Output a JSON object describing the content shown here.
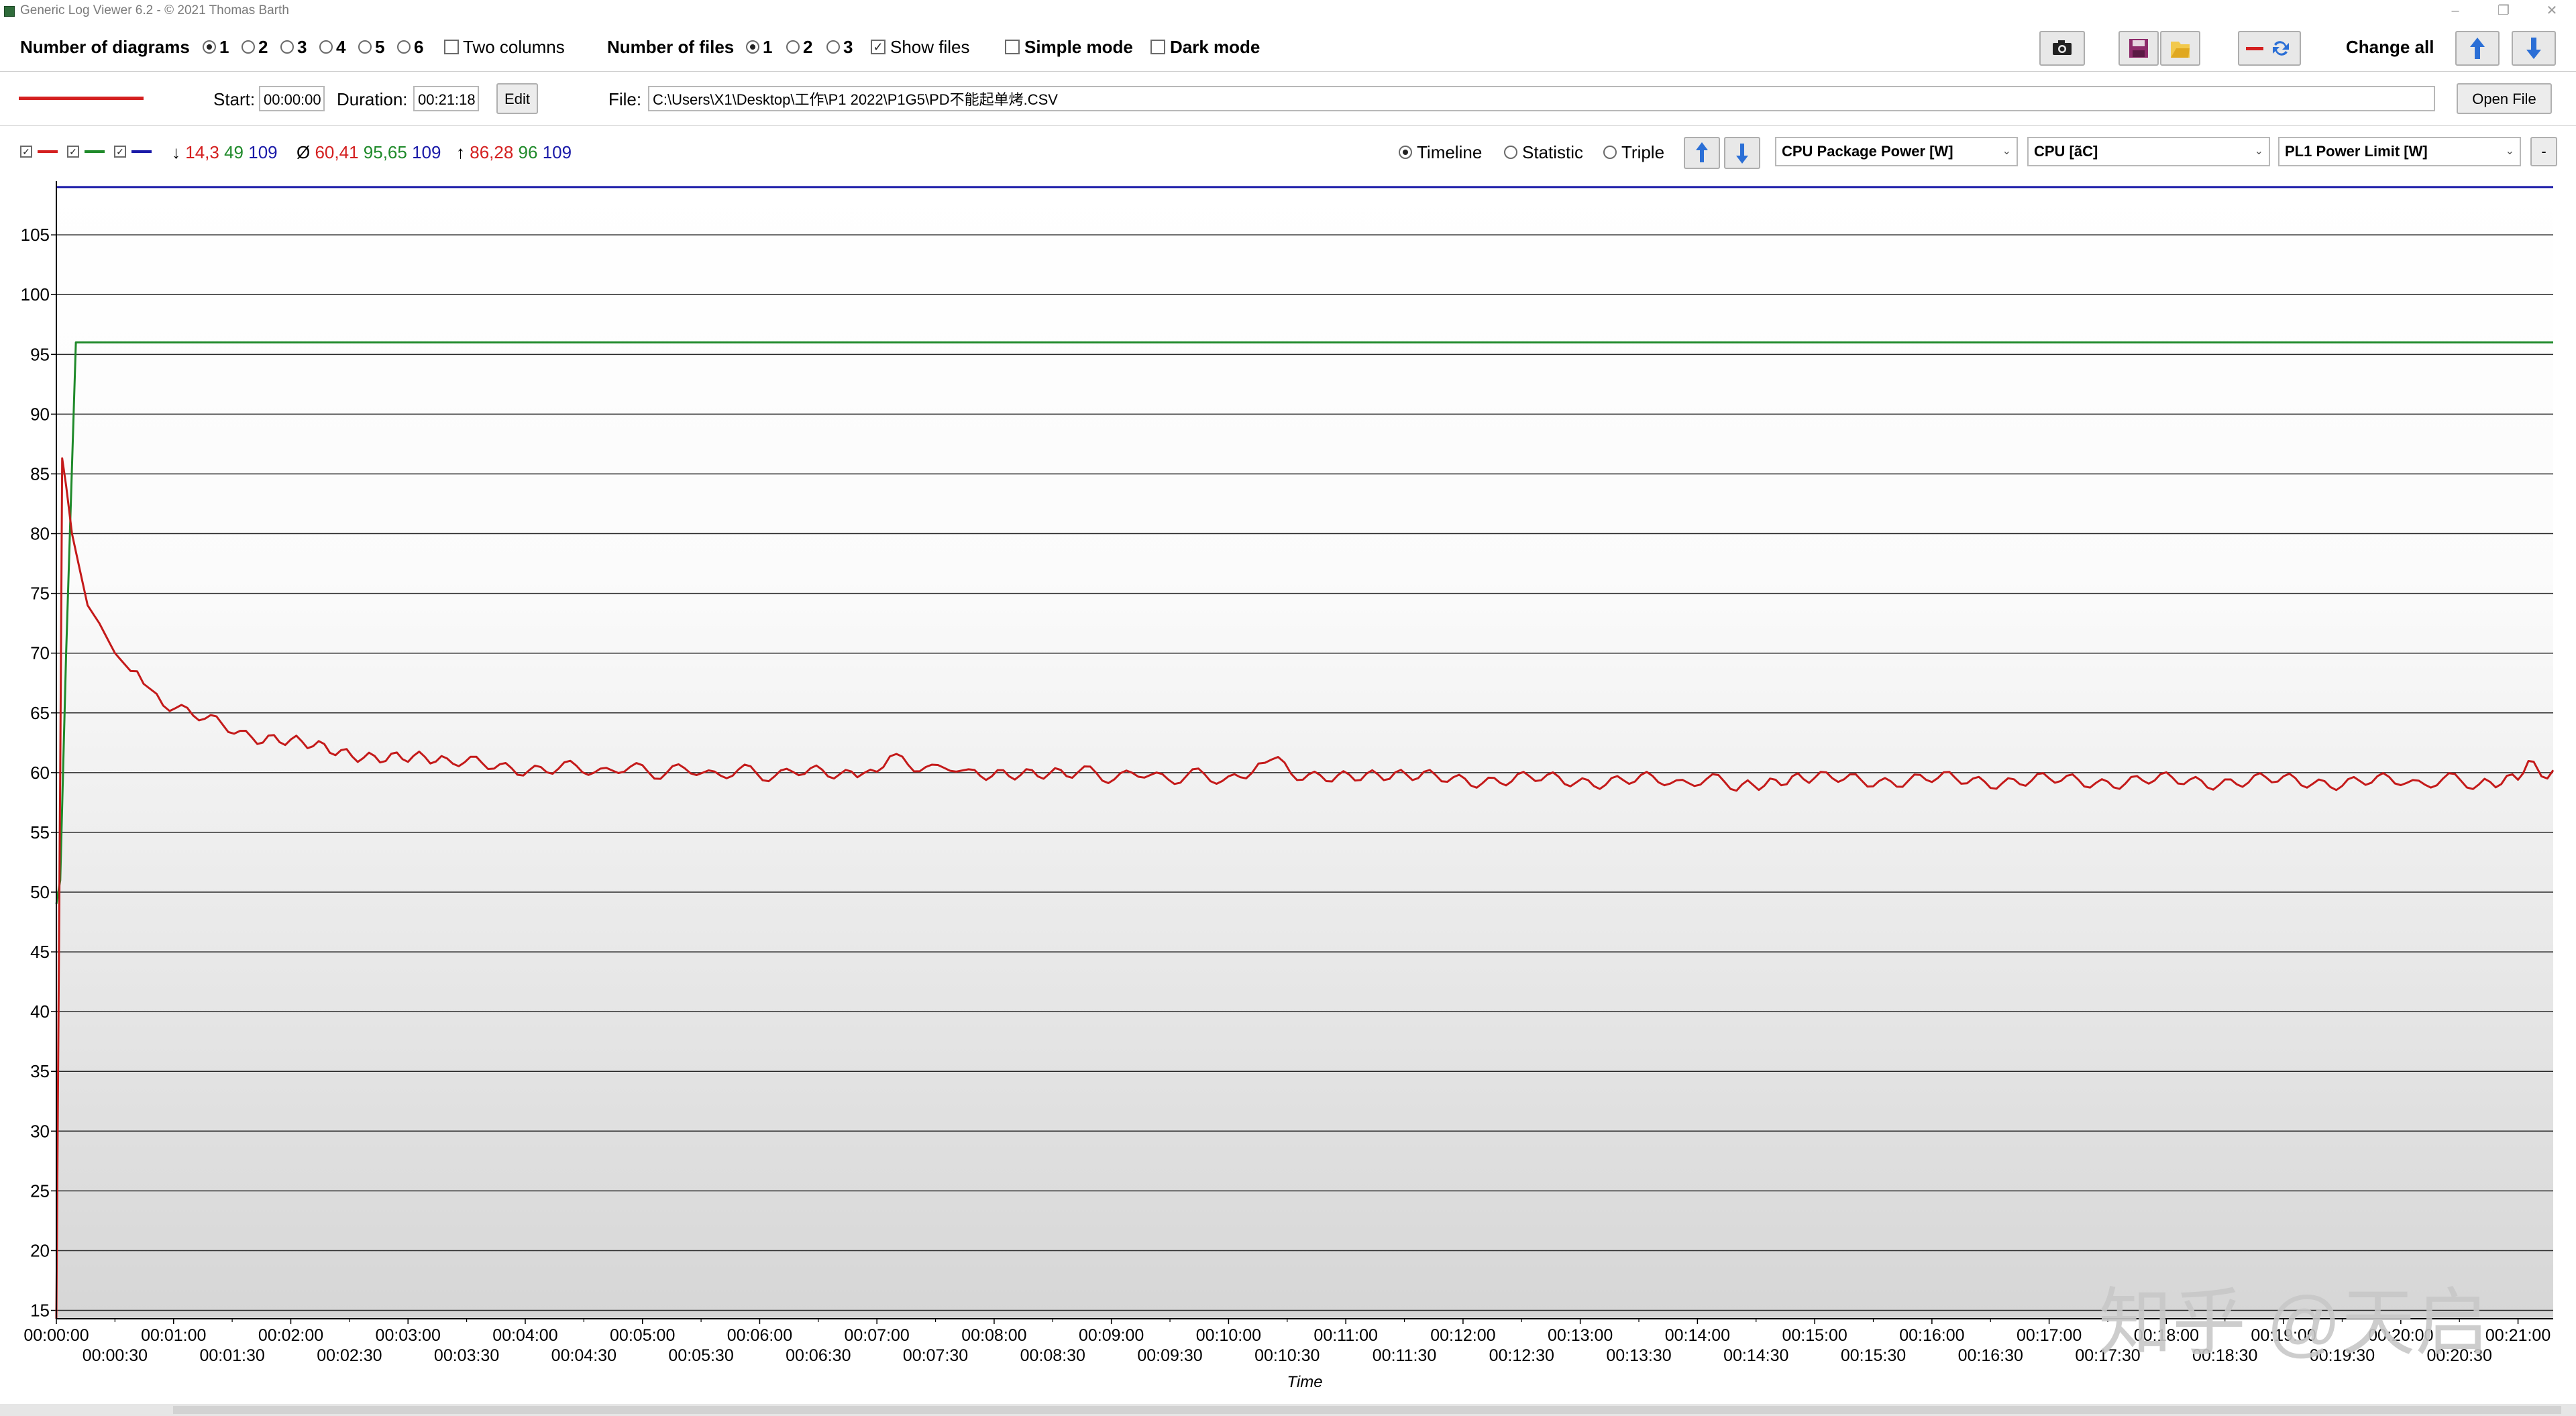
{
  "window": {
    "title": "Generic Log Viewer 6.2 - © 2021 Thomas Barth",
    "minimize": "–",
    "restore": "❐",
    "close": "✕"
  },
  "toolbar": {
    "num_diagrams_label": "Number of diagrams",
    "diagram_options": [
      "1",
      "2",
      "3",
      "4",
      "5",
      "6"
    ],
    "diagram_selected": "1",
    "two_columns_label": "Two columns",
    "num_files_label": "Number of files",
    "file_options": [
      "1",
      "2",
      "3"
    ],
    "file_selected": "1",
    "show_files_label": "Show files",
    "show_files_checked": true,
    "simple_mode_label": "Simple mode",
    "dark_mode_label": "Dark mode",
    "change_all_label": "Change all",
    "icons": [
      "camera-icon",
      "save-icon",
      "folder-icon",
      "swap-lines-icon",
      "arrow-up-icon",
      "arrow-down-icon"
    ]
  },
  "file_row": {
    "start_label": "Start:",
    "start_value": "00:00:00",
    "duration_label": "Duration:",
    "duration_value": "00:21:18",
    "edit_label": "Edit",
    "file_label": "File:",
    "file_path": "C:\\Users\\X1\\Desktop\\工作\\P1 2022\\P1G5\\PD不能起单烤.CSV",
    "open_file_label": "Open File",
    "line_color": "#d42020"
  },
  "diagram_header": {
    "series_colors": [
      "#d42020",
      "#1f8a2a",
      "#1a1aa8"
    ],
    "min_label": "↓",
    "min_values": [
      "14,3",
      "49",
      "109"
    ],
    "avg_label": "Ø",
    "avg_values": [
      "60,41",
      "95,65",
      "109"
    ],
    "max_label": "↑",
    "max_values": [
      "86,28",
      "96",
      "109"
    ],
    "mode_options": [
      "Timeline",
      "Statistic",
      "Triple"
    ],
    "mode_selected": "Timeline",
    "dropdowns": [
      "CPU Package Power [W]",
      "CPU [ãC]",
      "PL1 Power Limit [W]"
    ],
    "minus_button": "-"
  },
  "chart_data": {
    "type": "line",
    "xlabel": "Time",
    "x_ticks_upper": [
      "00:00:00",
      "00:01:00",
      "00:02:00",
      "00:03:00",
      "00:04:00",
      "00:05:00",
      "00:06:00",
      "00:07:00",
      "00:08:00",
      "00:09:00",
      "00:10:00",
      "00:11:00",
      "00:12:00",
      "00:13:00",
      "00:14:00",
      "00:15:00",
      "00:16:00",
      "00:17:00",
      "00:18:00",
      "00:19:00",
      "00:20:00",
      "00:21:00"
    ],
    "x_ticks_lower": [
      "00:00:30",
      "00:01:30",
      "00:02:30",
      "00:03:30",
      "00:04:30",
      "00:05:30",
      "00:06:30",
      "00:07:30",
      "00:08:30",
      "00:09:30",
      "00:10:30",
      "00:11:30",
      "00:12:30",
      "00:13:30",
      "00:14:30",
      "00:15:30",
      "00:16:30",
      "00:17:30",
      "00:18:30",
      "00:19:30",
      "00:20:30"
    ],
    "x_range_seconds": [
      0,
      1278
    ],
    "y_ticks": [
      15,
      20,
      25,
      30,
      35,
      40,
      45,
      50,
      55,
      60,
      65,
      70,
      75,
      80,
      85,
      90,
      95,
      100,
      105
    ],
    "ylim": [
      14.3,
      109.5
    ],
    "grid": true,
    "series": [
      {
        "color": "#1a1aa8",
        "points": [
          [
            0,
            109
          ],
          [
            1278,
            109
          ]
        ]
      },
      {
        "color": "#1f8a2a",
        "points": [
          [
            0,
            49
          ],
          [
            2,
            51
          ],
          [
            5,
            70
          ],
          [
            10,
            96
          ],
          [
            1278,
            96
          ]
        ]
      },
      {
        "color": "#c41a1a",
        "points": [
          [
            0,
            14.3
          ],
          [
            2,
            60
          ],
          [
            3,
            86.3
          ],
          [
            5,
            84
          ],
          [
            8,
            80
          ],
          [
            12,
            77
          ],
          [
            16,
            74
          ],
          [
            22,
            72.5
          ],
          [
            30,
            70
          ],
          [
            38,
            68.5
          ],
          [
            48,
            67
          ],
          [
            58,
            65.8
          ],
          [
            70,
            64.8
          ],
          [
            85,
            63.8
          ],
          [
            100,
            63
          ],
          [
            120,
            62.4
          ],
          [
            140,
            62
          ],
          [
            160,
            61.5
          ],
          [
            180,
            61.1
          ],
          [
            200,
            60.8
          ],
          [
            230,
            60.5
          ],
          [
            260,
            60.3
          ],
          [
            300,
            60.2
          ],
          [
            340,
            60
          ],
          [
            380,
            59.9
          ],
          [
            410,
            60.1
          ],
          [
            420,
            60.6
          ],
          [
            430,
            61.1
          ],
          [
            445,
            60.5
          ],
          [
            470,
            60.1
          ],
          [
            520,
            59.9
          ],
          [
            560,
            59.7
          ],
          [
            600,
            59.6
          ],
          [
            612,
            60.2
          ],
          [
            622,
            60.9
          ],
          [
            632,
            60.2
          ],
          [
            650,
            59.6
          ],
          [
            700,
            59.5
          ],
          [
            760,
            59.4
          ],
          [
            820,
            59.3
          ],
          [
            860,
            59.2
          ],
          [
            880,
            59
          ],
          [
            900,
            59.4
          ],
          [
            960,
            59.4
          ],
          [
            1020,
            59.3
          ],
          [
            1080,
            59.3
          ],
          [
            1140,
            59.3
          ],
          [
            1200,
            59.2
          ],
          [
            1240,
            59.3
          ],
          [
            1260,
            59.6
          ],
          [
            1268,
            60.8
          ],
          [
            1272,
            59.6
          ],
          [
            1278,
            60.2
          ]
        ]
      }
    ]
  },
  "watermark": "知乎 @天启"
}
